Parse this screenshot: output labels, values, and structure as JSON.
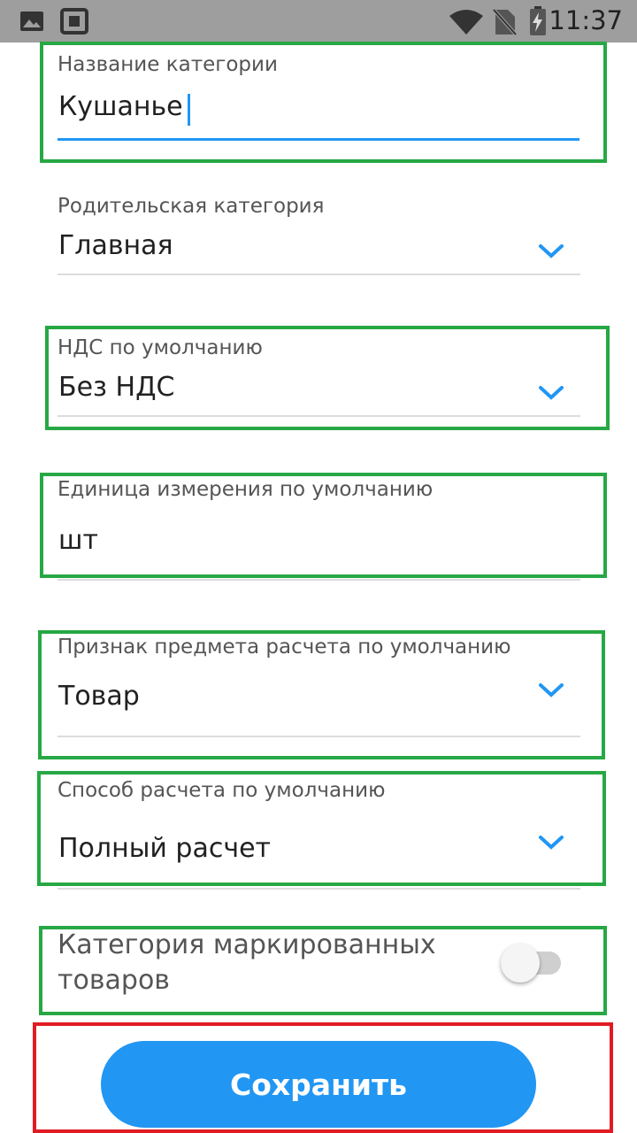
{
  "status_bar": {
    "time": "11:37",
    "icons": [
      "image-icon",
      "screenshot-icon",
      "wifi-icon",
      "no-sim-icon",
      "battery-charging-icon"
    ]
  },
  "fields": {
    "category_name": {
      "label": "Название категории",
      "value": "Кушанье"
    },
    "parent_category": {
      "label": "Родительская категория",
      "value": "Главная"
    },
    "vat_default": {
      "label": "НДС по умолчанию",
      "value": "Без НДС"
    },
    "unit_default": {
      "label": "Единица измерения по умолчанию",
      "value": "шт"
    },
    "subject_attr_default": {
      "label": "Признак предмета расчета по умолчанию",
      "value": "Товар"
    },
    "payment_method_default": {
      "label": "Способ расчета по умолчанию",
      "value": "Полный расчет"
    },
    "marked_goods": {
      "label_line1": "Категория маркированных",
      "label_line2": "товаров",
      "enabled": false
    }
  },
  "save_button": {
    "label": "Сохранить"
  },
  "colors": {
    "accent": "#2196f3",
    "annotation_green": "#27a844",
    "annotation_red": "#e21b23",
    "status_bar": "#9e9e9e"
  }
}
